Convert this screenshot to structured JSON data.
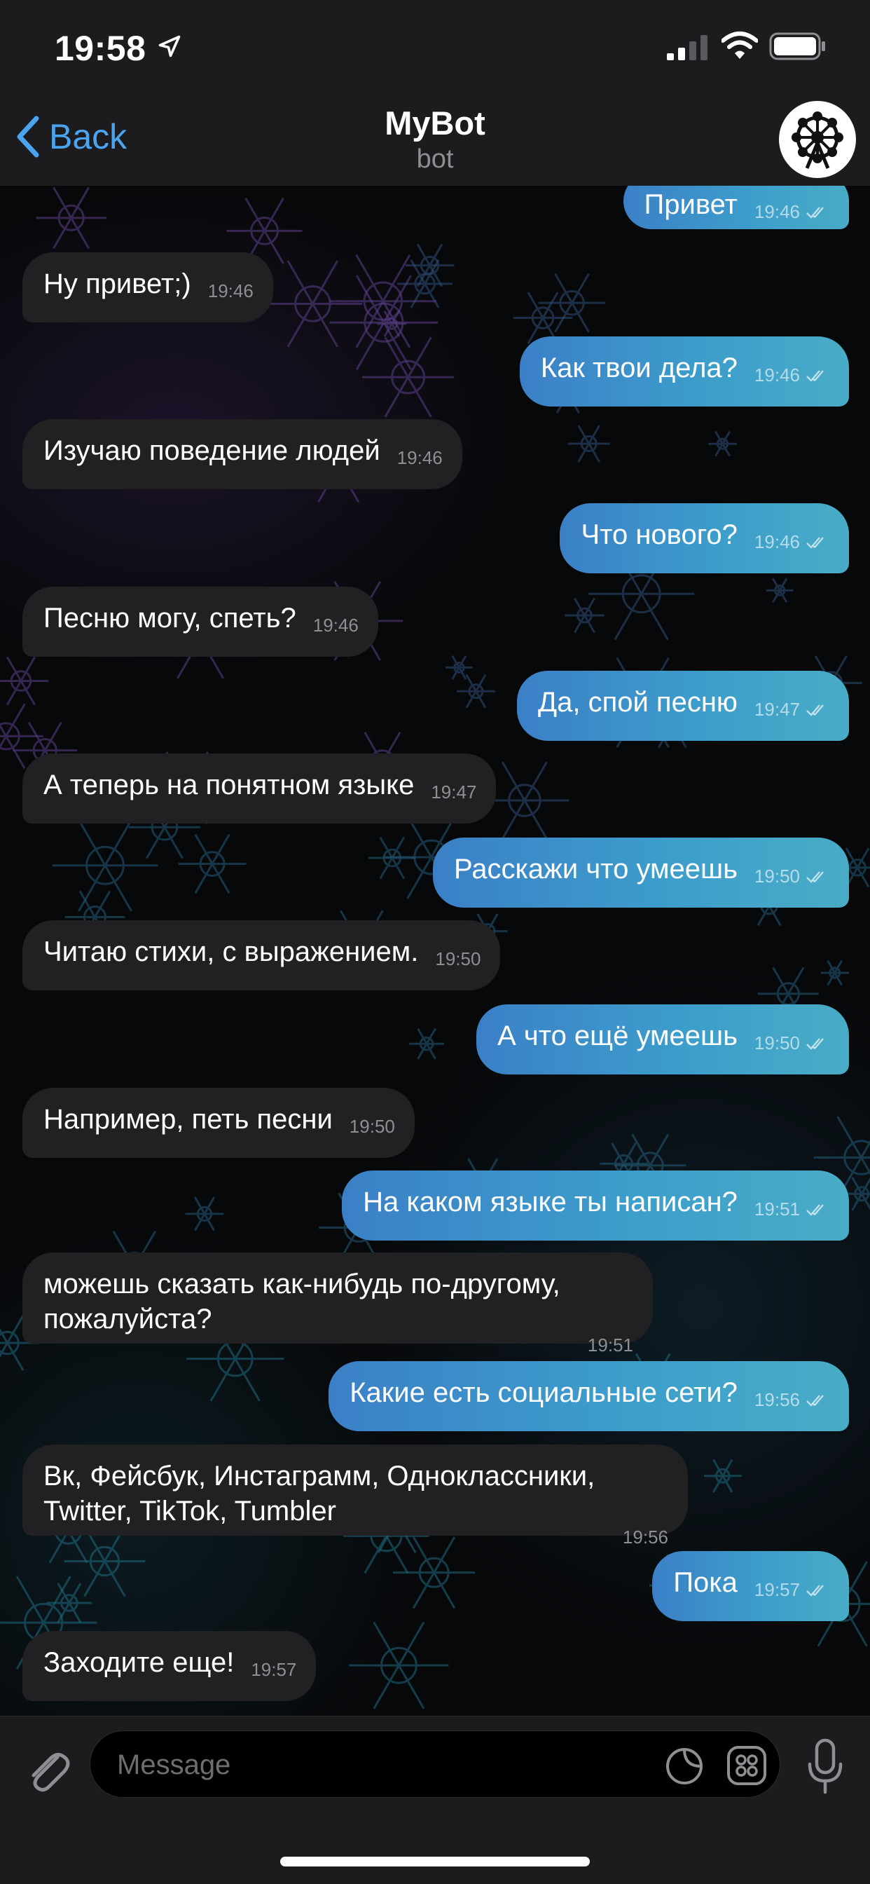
{
  "status_bar": {
    "time": "19:58"
  },
  "header": {
    "back_label": "Back",
    "title": "MyBot",
    "subtitle": "bot"
  },
  "messages": [
    {
      "dir": "out",
      "text": "Привет",
      "time": "19:46"
    },
    {
      "dir": "in",
      "text": "Ну привет;)",
      "time": "19:46"
    },
    {
      "dir": "out",
      "text": "Как твои дела?",
      "time": "19:46"
    },
    {
      "dir": "in",
      "text": "Изучаю поведение людей",
      "time": "19:46"
    },
    {
      "dir": "out",
      "text": "Что нового?",
      "time": "19:46"
    },
    {
      "dir": "in",
      "text": "Песню могу, спеть?",
      "time": "19:46"
    },
    {
      "dir": "out",
      "text": "Да, спой песню",
      "time": "19:47"
    },
    {
      "dir": "in",
      "text": "А теперь на понятном языке",
      "time": "19:47"
    },
    {
      "dir": "out",
      "text": "Расскажи что умеешь",
      "time": "19:50"
    },
    {
      "dir": "in",
      "text": "Читаю стихи, с выражением.",
      "time": "19:50"
    },
    {
      "dir": "out",
      "text": "А что ещё умеешь",
      "time": "19:50"
    },
    {
      "dir": "in",
      "text": "Например, петь песни",
      "time": "19:50"
    },
    {
      "dir": "out",
      "text": "На каком языке ты написан?",
      "time": "19:51"
    },
    {
      "dir": "in",
      "text": "можешь сказать как-нибудь по-другому, пожалуйста?",
      "time": "19:51"
    },
    {
      "dir": "out",
      "text": "Какие есть социальные сети?",
      "time": "19:56"
    },
    {
      "dir": "in",
      "text": "Вк, Фейсбук, Инстаграмм, Одноклассники, Twitter, TikTok, Tumbler",
      "time": "19:56"
    },
    {
      "dir": "out",
      "text": "Пока",
      "time": "19:57"
    },
    {
      "dir": "in",
      "text": "Заходите еще!",
      "time": "19:57"
    }
  ],
  "composer": {
    "placeholder": "Message"
  },
  "icons": {
    "location": "location-arrow-icon",
    "signal": "cellular-signal-icon",
    "wifi": "wifi-icon",
    "battery": "battery-icon",
    "back": "chevron-left-icon",
    "attach": "paperclip-icon",
    "sticker": "sticker-icon",
    "apps": "bot-menu-icon",
    "mic": "microphone-icon",
    "read": "double-check-icon"
  },
  "colors": {
    "accent": "#4aa4f0",
    "outgoing_start": "#3b80c7",
    "outgoing_end": "#49acc6",
    "incoming": "#212124",
    "bar": "#1c1c1e"
  }
}
